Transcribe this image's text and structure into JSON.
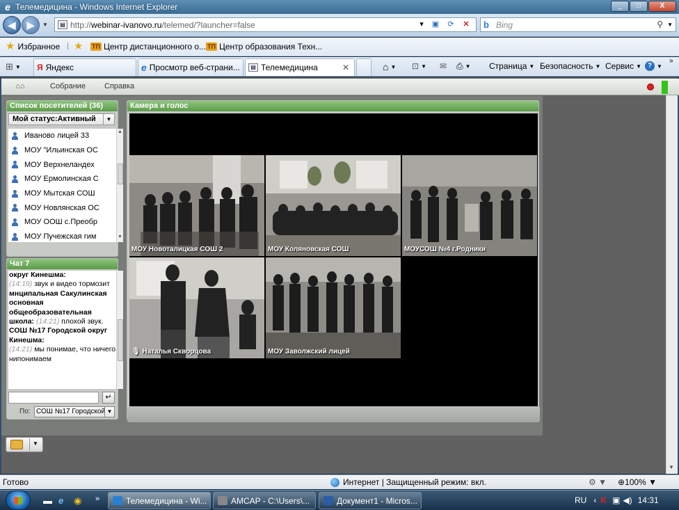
{
  "window": {
    "title": "Телемедицина - Windows Internet Explorer",
    "min": "_",
    "max": "□",
    "close": "X"
  },
  "address": {
    "url_prefix": "http://",
    "url_host": "webinar-ivanovo.ru",
    "url_path": "/telemed/?launcher=false",
    "search_placeholder": "Bing"
  },
  "favorites": {
    "label": "Избранное",
    "items": [
      "Центр дистанционного о...",
      "Центр образования Техн..."
    ]
  },
  "tabs": {
    "quicktabs": [
      "Яндекс"
    ],
    "items": [
      "Просмотр веб-страни...",
      "Телемедицина"
    ],
    "active": 1,
    "commands": [
      "Страница",
      "Безопасность",
      "Сервис"
    ]
  },
  "app": {
    "menu": [
      "Собрание",
      "Справка"
    ],
    "visitors": {
      "title": "Список посетителей (36)",
      "status": "Мой статус:Активный",
      "list": [
        "Иваново лицей 33",
        "МОУ \"Ильинская ОС",
        "МОУ Верхнеландех",
        "МОУ Ермолинская С",
        "МОУ Мытская СОШ",
        "МОУ Новлянская ОС",
        "МОУ ООШ с.Преобр",
        "МОУ Пучежская гим"
      ]
    },
    "chat": {
      "title": "Чат 7",
      "messages": [
        {
          "name": "округ Кинешма:",
          "time": "(14:19)",
          "text": "звук и видео тормозит"
        },
        {
          "name": "мнципальная Сакулинская основная общеобразовательная школа:",
          "time": "(14:21)",
          "text": "плохой звук."
        },
        {
          "name": "СОШ №17 Городской округ Кинешма:",
          "time": "(14:21)",
          "text": "мы понимае, что ничего нипонимаем"
        }
      ],
      "input_value": "",
      "send_icon": "↵",
      "to_label": "По:",
      "to_value": "СОШ №17 Городской"
    },
    "camera": {
      "title": "Камера и голос",
      "tiles": [
        "МОУ Новоталицкая СОШ 2",
        "МОУ Коляновская СОШ",
        "МОУСОШ №4 г.Родники",
        "Наталья Скворцова",
        "МОУ Заволжский лицей"
      ]
    }
  },
  "statusbar": {
    "status": "Готово",
    "zone": "Интернет | Защищенный режим: вкл.",
    "zoom": "100%"
  },
  "taskbar": {
    "tasks": [
      "Телемедицина - Wi...",
      "AMCAP - C:\\Users\\...",
      "Документ1 - Micros..."
    ],
    "lang": "RU",
    "time": "14:31"
  },
  "colors": {
    "panel_header": "#6fa95c",
    "title_bar": "#4a7ea6"
  }
}
